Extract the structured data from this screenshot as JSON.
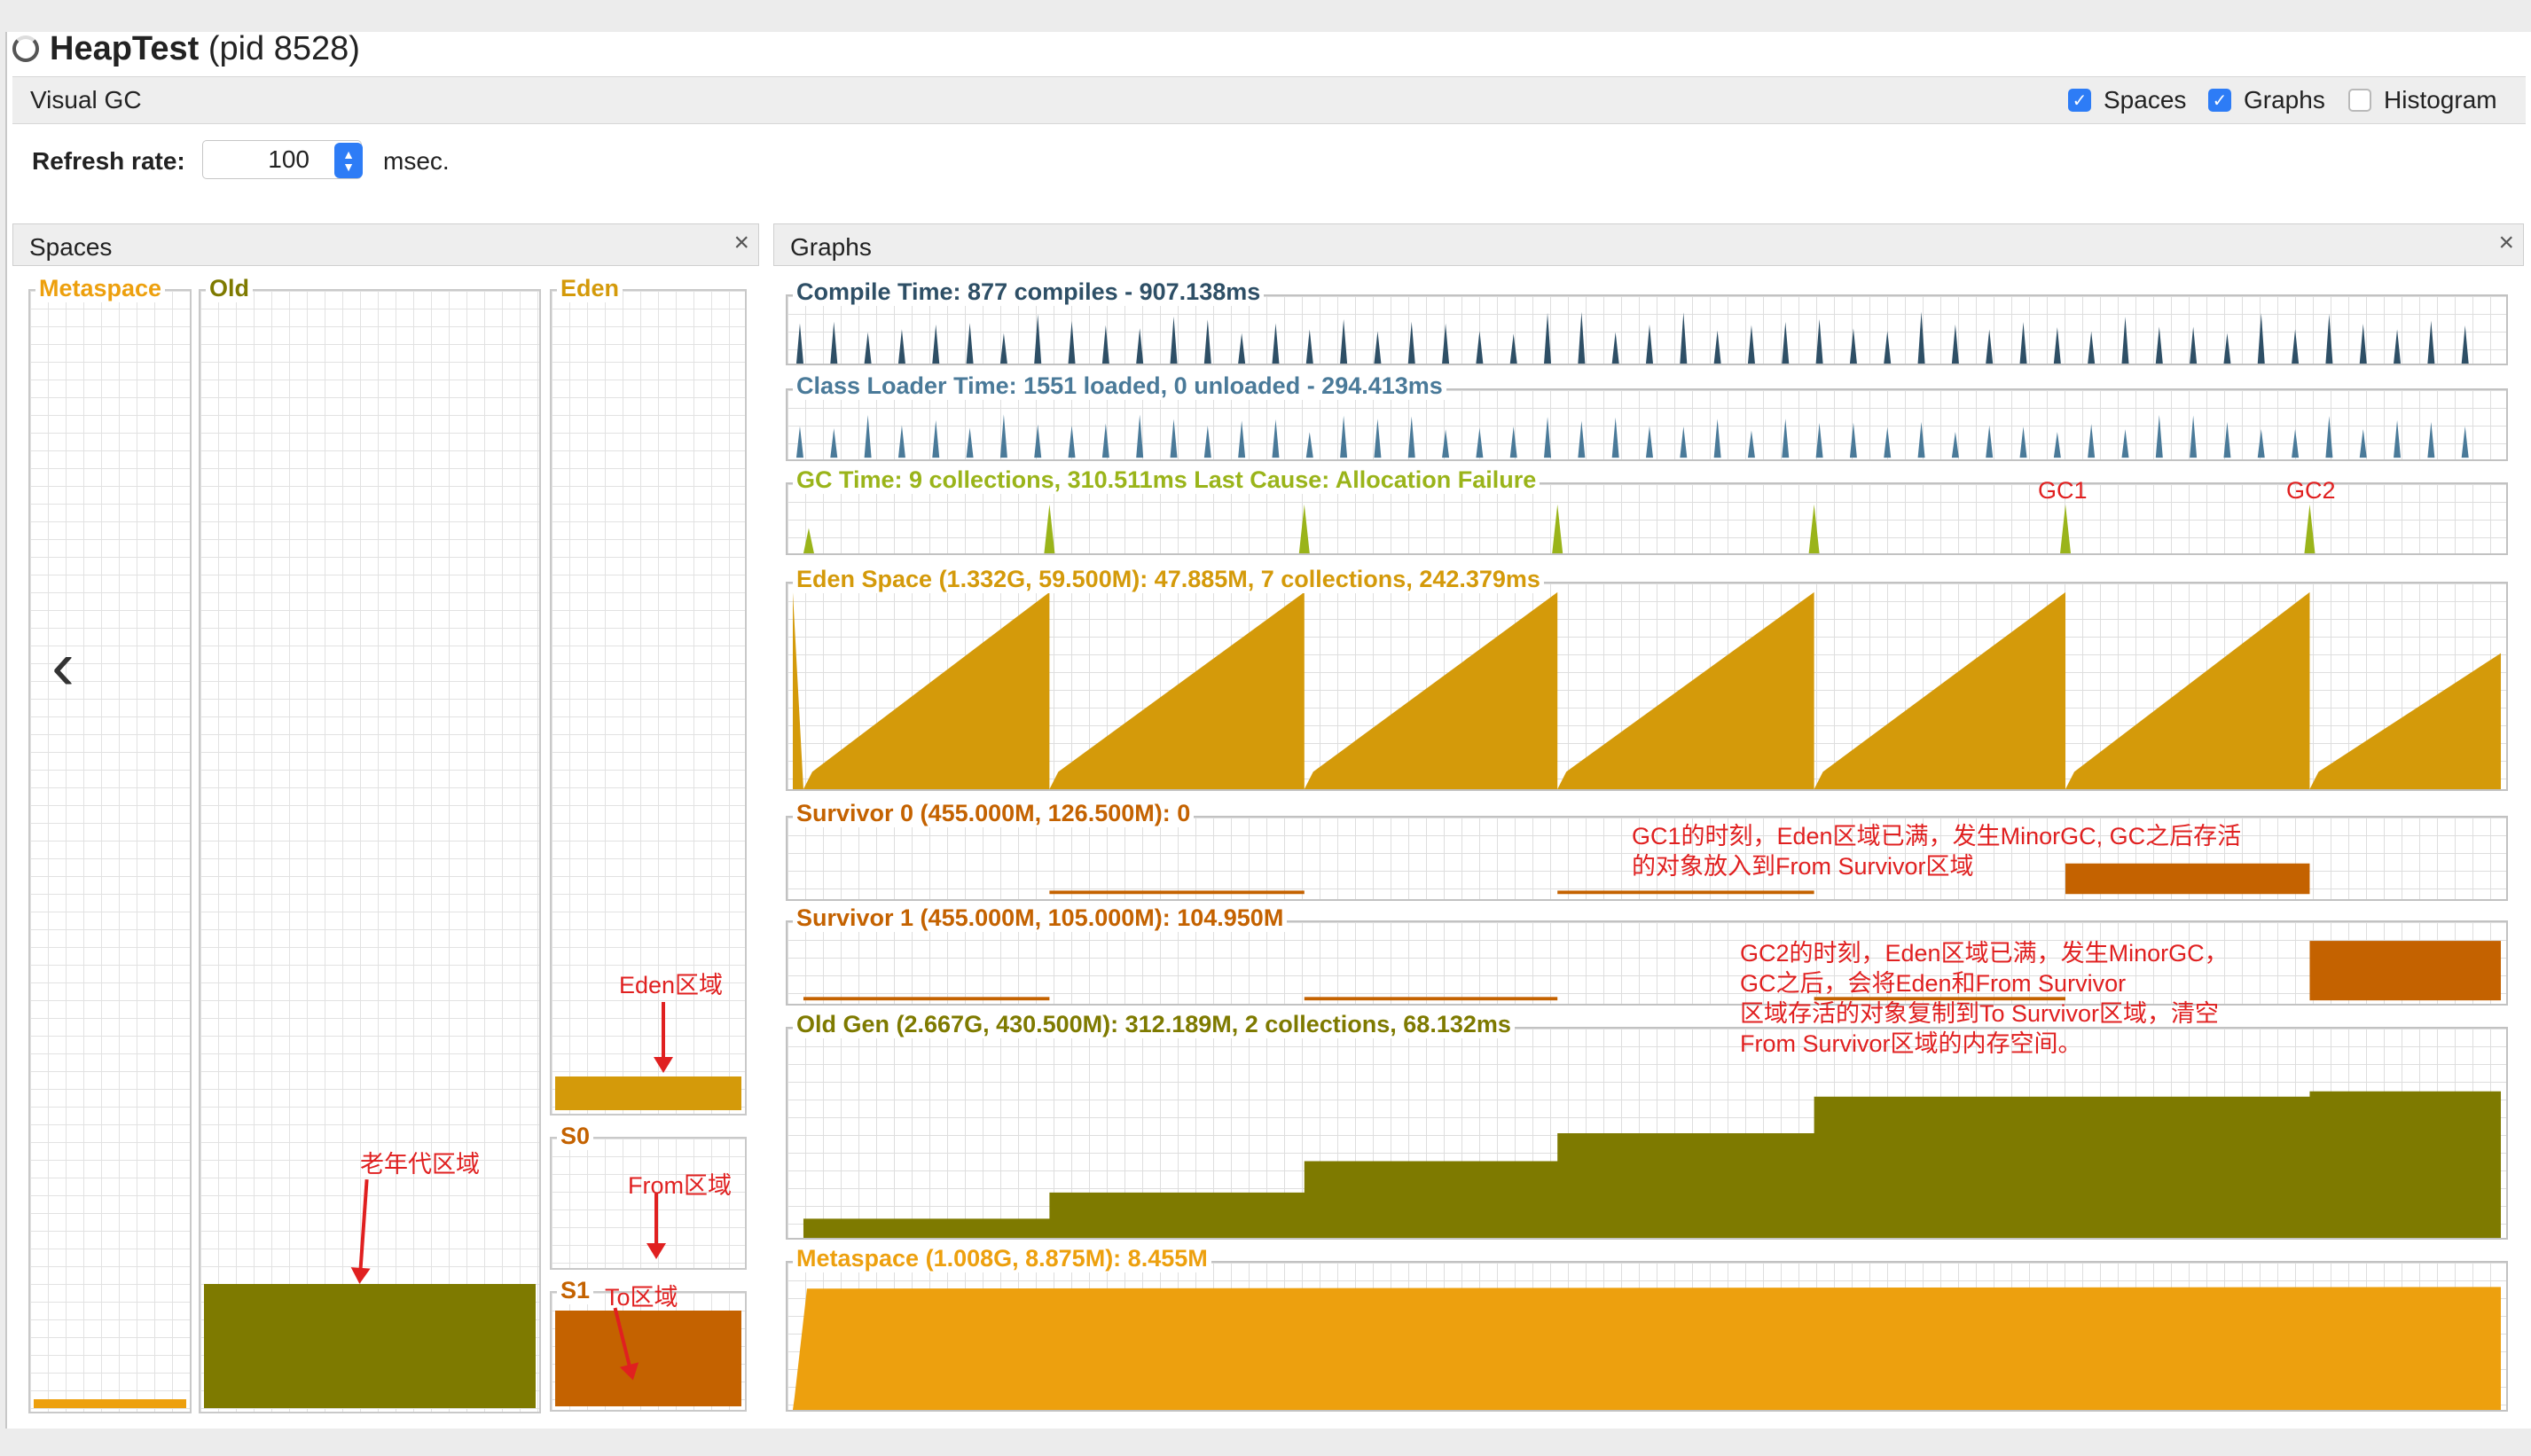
{
  "window": {
    "app_name": "HeapTest",
    "pid_text": "(pid 8528)"
  },
  "tab": {
    "label": "Visual GC"
  },
  "options": {
    "spaces": {
      "label": "Spaces",
      "checked": true
    },
    "graphs": {
      "label": "Graphs",
      "checked": true
    },
    "histogram": {
      "label": "Histogram",
      "checked": false
    }
  },
  "refresh": {
    "label": "Refresh rate:",
    "value": "100",
    "unit": "msec."
  },
  "spaces_panel": {
    "title": "Spaces",
    "close": "×",
    "metaspace": "Metaspace",
    "old": "Old",
    "eden": "Eden",
    "s0": "S0",
    "s1": "S1"
  },
  "graphs_panel": {
    "title": "Graphs",
    "close": "×",
    "compile": "Compile Time: 877 compiles - 907.138ms",
    "classloader": "Class Loader Time: 1551 loaded, 0 unloaded - 294.413ms",
    "gc": "GC Time: 9 collections, 310.511ms Last Cause: Allocation Failure",
    "eden": "Eden Space (1.332G, 59.500M): 47.885M, 7 collections, 242.379ms",
    "survivor0": "Survivor 0 (455.000M, 126.500M): 0",
    "survivor1": "Survivor 1 (455.000M, 105.000M): 104.950M",
    "oldgen": "Old Gen (2.667G, 430.500M): 312.189M, 2 collections, 68.132ms",
    "metaspace": "Metaspace (1.008G, 8.875M): 8.455M"
  },
  "annotations": {
    "gc1": "GC1",
    "gc2": "GC2",
    "note1_line1": "GC1的时刻，Eden区域已满，发生MinorGC, GC之后存活",
    "note1_line2": "的对象放入到From Survivor区域",
    "note2_line1": "GC2的时刻，Eden区域已满，发生MinorGC，",
    "note2_line2": "GC之后，会将Eden和From Survivor",
    "note2_line3": "区域存活的对象复制到To Survivor区域，清空",
    "note2_line4": "From Survivor区域的内存空间。",
    "eden_area": "Eden区域",
    "old_area": "老年代区域",
    "from_area": "From区域",
    "to_area": "To区域"
  },
  "nav": {
    "prev": "‹"
  },
  "colors": {
    "compile": "#2e4f66",
    "classloader": "#4a7a99",
    "gc": "#9ab41a",
    "eden": "#d49a0a",
    "survivor": "#c46200",
    "oldgen": "#7e7a00",
    "metaspace": "#eda00e",
    "annotation": "#e02020"
  }
}
